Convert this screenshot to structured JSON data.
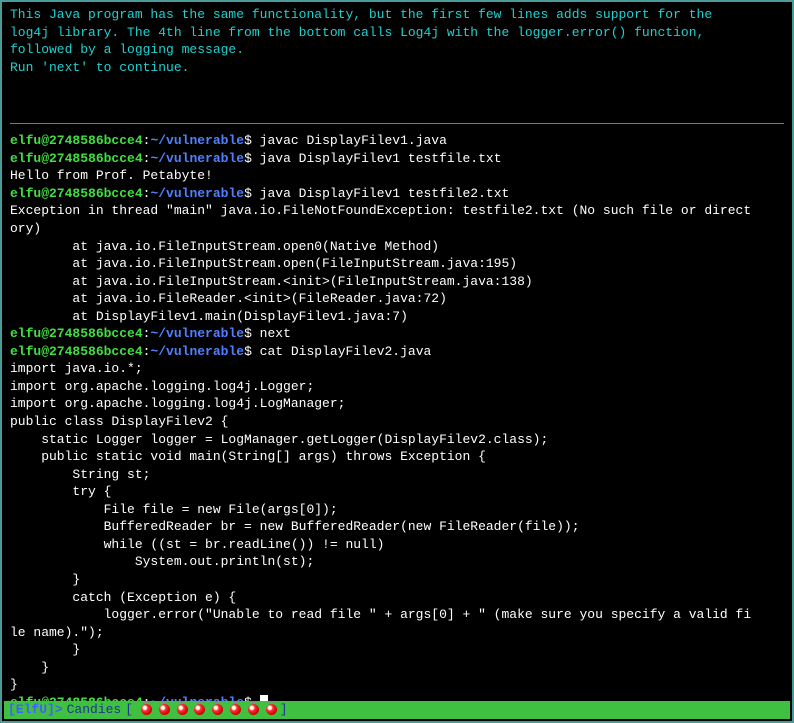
{
  "intro": {
    "line1": "This Java program has the same functionality, but the first few lines adds support for the",
    "line2": "log4j library. The 4th line from the bottom calls Log4j with the logger.error() function,",
    "line3": "followed by a logging message.",
    "line4": "Run 'next' to continue."
  },
  "prompt": {
    "user_host": "elfu@2748586bcce4",
    "colon": ":",
    "path": "~/vulnerable",
    "dollar": "$"
  },
  "commands": {
    "cmd1": " javac DisplayFilev1.java",
    "cmd2": " java DisplayFilev1 testfile.txt",
    "out1": "Hello from Prof. Petabyte!",
    "cmd3": " java DisplayFilev1 testfile2.txt",
    "exc1": "Exception in thread \"main\" java.io.FileNotFoundException: testfile2.txt (No such file or direct",
    "exc2": "ory)",
    "st1": "        at java.io.FileInputStream.open0(Native Method)",
    "st2": "        at java.io.FileInputStream.open(FileInputStream.java:195)",
    "st3": "        at java.io.FileInputStream.<init>(FileInputStream.java:138)",
    "st4": "        at java.io.FileReader.<init>(FileReader.java:72)",
    "st5": "        at DisplayFilev1.main(DisplayFilev1.java:7)",
    "cmd4": " next",
    "cmd5": " cat DisplayFilev2.java"
  },
  "java": {
    "l1": "import java.io.*;",
    "l2": "import org.apache.logging.log4j.Logger;",
    "l3": "import org.apache.logging.log4j.LogManager;",
    "l4": "",
    "l5": "public class DisplayFilev2 {",
    "l6": "    static Logger logger = LogManager.getLogger(DisplayFilev2.class);",
    "l7": "    public static void main(String[] args) throws Exception {",
    "l8": "        String st;",
    "l9": "        try {",
    "l10": "            File file = new File(args[0]);",
    "l11": "            BufferedReader br = new BufferedReader(new FileReader(file));",
    "l12": "",
    "l13": "            while ((st = br.readLine()) != null)",
    "l14": "                System.out.println(st);",
    "l15": "        }",
    "l16": "        catch (Exception e) {",
    "l17": "            logger.error(\"Unable to read file \" + args[0] + \" (make sure you specify a valid fi",
    "l18": "le name).\");",
    "l19": "        }",
    "l20": "    }",
    "l21": "}"
  },
  "status": {
    "tag": "[ElfU]",
    "gt": ">",
    "label": "Candies",
    "bracket_open": "[",
    "bracket_close": "]"
  }
}
